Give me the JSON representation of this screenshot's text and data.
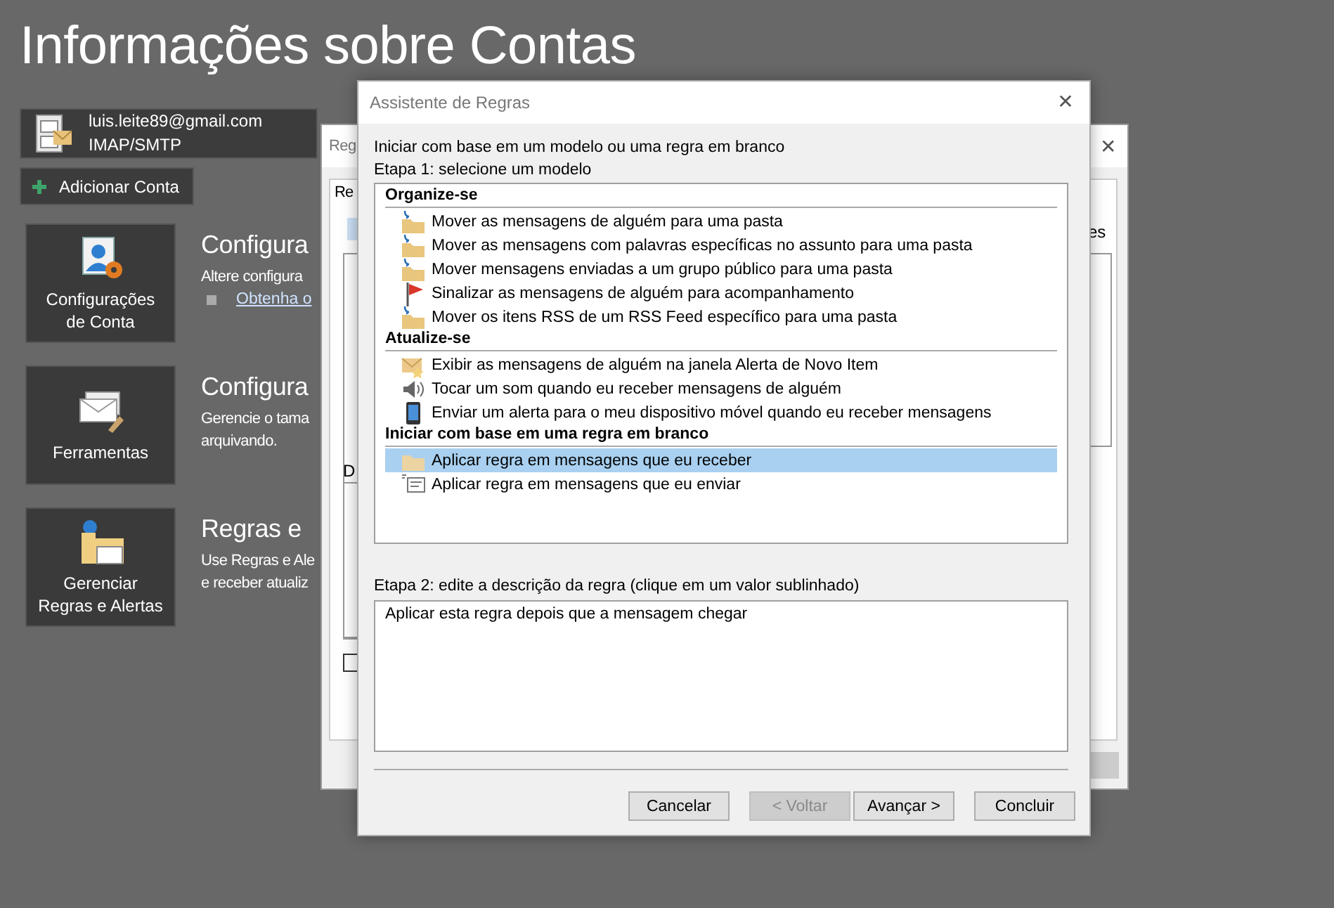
{
  "page": {
    "title": "Informações sobre Contas",
    "account": {
      "email": "luis.leite89@gmail.com",
      "type": "IMAP/SMTP"
    },
    "add_account": "Adicionar Conta",
    "sections": [
      {
        "kind": "account",
        "tile": "Configurações de Conta",
        "heading": "Configura",
        "lines": [
          "Altere configura"
        ],
        "link": "Obtenha o"
      },
      {
        "kind": "tools",
        "tile": "Ferramentas",
        "heading": "Configura",
        "lines": [
          "Gerencie o tama",
          "arquivando."
        ]
      },
      {
        "kind": "rules",
        "tile": "Gerenciar Regras e Alertas",
        "heading": "Regras e",
        "lines": [
          "Use Regras e Ale",
          "e receber atualiz"
        ]
      }
    ]
  },
  "back_dialog": {
    "title": "Reg",
    "close": "✕",
    "tab": "Re",
    "label": "D",
    "column_text": "es",
    "checkbox_checked": false
  },
  "dialog": {
    "title": "Assistente de Regras",
    "close": "✕",
    "intro": "Iniciar com base em um modelo ou uma regra em branco",
    "step1": "Etapa 1: selecione um modelo",
    "groups": [
      {
        "heading": "Organize-se",
        "items": [
          {
            "kind": "move",
            "label": "Mover as mensagens de alguém para uma pasta",
            "selected": false
          },
          {
            "kind": "move",
            "label": "Mover as mensagens com palavras específicas no assunto para uma pasta",
            "selected": false
          },
          {
            "kind": "move",
            "label": "Mover mensagens enviadas a um grupo público para uma pasta",
            "selected": false
          },
          {
            "kind": "flag",
            "label": "Sinalizar as mensagens de alguém para acompanhamento",
            "selected": false
          },
          {
            "kind": "move",
            "label": "Mover os itens RSS de um RSS Feed específico para uma pasta",
            "selected": false
          }
        ]
      },
      {
        "heading": "Atualize-se",
        "items": [
          {
            "kind": "alert",
            "label": "Exibir as mensagens de alguém na janela Alerta de Novo Item",
            "selected": false
          },
          {
            "kind": "sound",
            "label": "Tocar um som quando eu receber mensagens de alguém",
            "selected": false
          },
          {
            "kind": "phone",
            "label": "Enviar um alerta para o meu dispositivo móvel quando eu receber mensagens",
            "selected": false
          }
        ]
      },
      {
        "heading": "Iniciar com base em uma regra em branco",
        "items": [
          {
            "kind": "receive",
            "label": "Aplicar regra em mensagens que eu receber",
            "selected": true
          },
          {
            "kind": "send",
            "label": "Aplicar regra em mensagens que eu enviar",
            "selected": false
          }
        ]
      }
    ],
    "step2": "Etapa 2: edite a descrição da regra (clique em um valor sublinhado)",
    "description": "Aplicar esta regra depois que a mensagem chegar",
    "buttons": [
      {
        "label": "Cancelar",
        "disabled": false
      },
      {
        "label": "< Voltar",
        "disabled": true
      },
      {
        "label": "Avançar >",
        "disabled": false
      },
      {
        "label": "Concluir",
        "disabled": false
      }
    ]
  }
}
